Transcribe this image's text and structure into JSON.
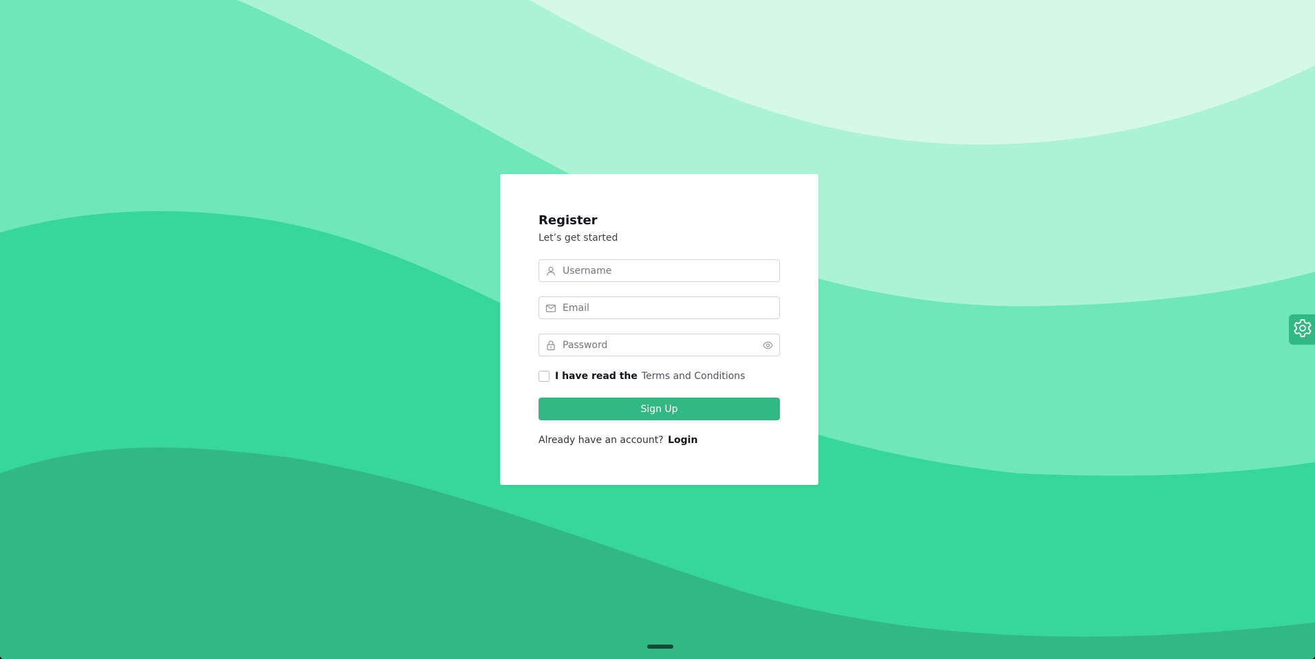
{
  "colors": {
    "background_lightest": "#d5f8e7",
    "background_light": "#abf3d4",
    "background_mid": "#6fe7b9",
    "background_green": "#37d699",
    "background_dark": "#31b883",
    "accent": "#31b883"
  },
  "register": {
    "title": "Register",
    "subtitle": "Let’s get started",
    "fields": {
      "username": {
        "placeholder": "Username",
        "icon": "user-icon"
      },
      "email": {
        "placeholder": "Email",
        "icon": "mail-icon"
      },
      "password": {
        "placeholder": "Password",
        "icon": "lock-icon",
        "toggle_icon": "eye-icon"
      }
    },
    "terms": {
      "prefix": "I have read the",
      "link": "Terms and Conditions",
      "checked": false
    },
    "submit_label": "Sign Up",
    "login_prompt": "Already have an account?",
    "login_link": "Login"
  },
  "settings": {
    "icon": "gear-icon"
  }
}
